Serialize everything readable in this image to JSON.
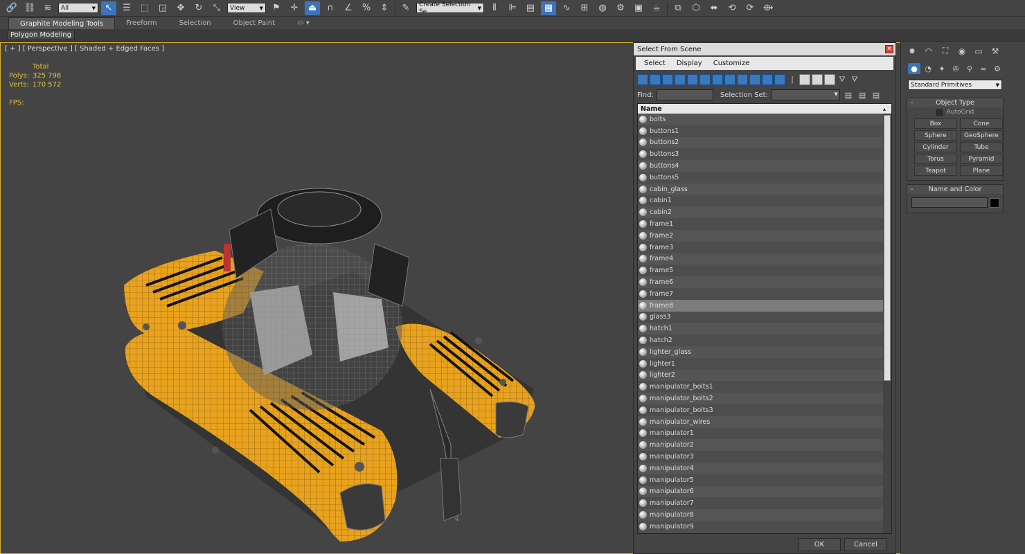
{
  "toolbar": {
    "selection_filter": "All",
    "ref_coord": "View",
    "named_sel_placeholder": "Create Selection Se",
    "icons": [
      "link-icon",
      "unlink-icon",
      "bind-spacewarp-icon",
      "select-object-icon",
      "select-by-name-icon",
      "rect-region-icon",
      "window-crossing-icon",
      "move-icon",
      "rotate-icon",
      "scale-icon",
      "pivot-icon",
      "select-manipulate-icon",
      "keyboard-shortcut-icon",
      "snap-3d-icon",
      "angle-snap-icon",
      "percent-snap-icon",
      "spinner-snap-icon",
      "edit-named-sel-icon",
      "mirror-icon",
      "align-icon",
      "layer-manager-icon",
      "graphite-toggle-icon",
      "curve-editor-icon",
      "schematic-view-icon",
      "material-editor-icon",
      "render-setup-icon",
      "rendered-frame-icon",
      "render-icon"
    ]
  },
  "ribbon": {
    "tabs": [
      "Graphite Modeling Tools",
      "Freeform",
      "Selection",
      "Object Paint"
    ],
    "active_tab": "Graphite Modeling Tools",
    "panel_label": "Polygon Modeling"
  },
  "viewport": {
    "label": "[ + ] [ Perspective ] [ Shaded + Edged Faces ]",
    "stats_total": "Total",
    "polys_label": "Polys:",
    "polys_value": "325 798",
    "verts_label": "Verts:",
    "verts_value": "170 572",
    "fps_label": "FPS:"
  },
  "dialog": {
    "title": "Select From Scene",
    "menu": [
      "Select",
      "Display",
      "Customize"
    ],
    "find_label": "Find:",
    "selection_set_label": "Selection Set:",
    "column_name": "Name",
    "items": [
      "bolts",
      "buttons1",
      "buttons2",
      "buttons3",
      "buttons4",
      "buttons5",
      "cabin_glass",
      "cabin1",
      "cabin2",
      "frame1",
      "frame2",
      "frame3",
      "frame4",
      "frame5",
      "frame6",
      "frame7",
      "frame8",
      "glass3",
      "hatch1",
      "hatch2",
      "lighter_glass",
      "lighter1",
      "lighter2",
      "manipulator_bolts1",
      "manipulator_bolts2",
      "manipulator_bolts3",
      "manipulator_wires",
      "manipulator1",
      "manipulator2",
      "manipulator3",
      "manipulator4",
      "manipulator5",
      "manipulator6",
      "manipulator7",
      "manipulator8",
      "manipulator9"
    ],
    "selected_item": "frame8",
    "ok_label": "OK",
    "cancel_label": "Cancel"
  },
  "command_panel": {
    "dropdown": "Standard Primitives",
    "object_type_title": "Object Type",
    "autogrid_label": "AutoGrid",
    "buttons": [
      "Box",
      "Cone",
      "Sphere",
      "GeoSphere",
      "Cylinder",
      "Tube",
      "Torus",
      "Pyramid",
      "Teapot",
      "Plane"
    ],
    "name_color_title": "Name and Color",
    "object_color": "#000000"
  },
  "colors": {
    "viewport_border": "#d3b030",
    "stats_text": "#e0c33a",
    "model_body": "#e8a21e",
    "accent": "#3b74b8"
  }
}
